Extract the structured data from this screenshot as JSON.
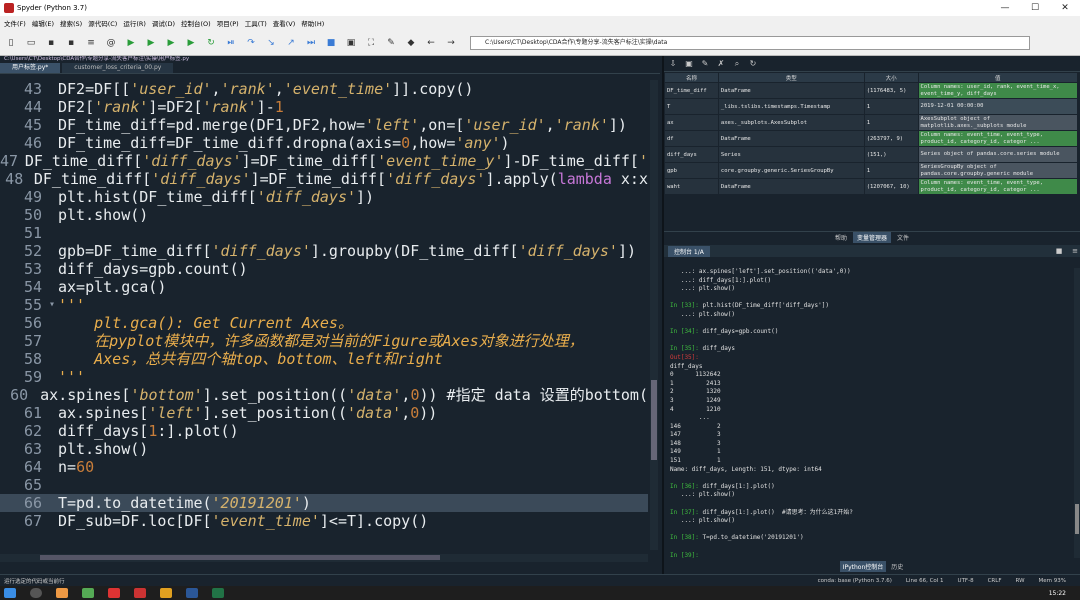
{
  "window": {
    "title": "Spyder (Python 3.7)",
    "minimize": "—",
    "maximize": "☐",
    "close": "✕"
  },
  "menu": [
    "文件(F)",
    "编辑(E)",
    "搜索(S)",
    "源代码(C)",
    "运行(R)",
    "调试(D)",
    "控制台(O)",
    "项目(P)",
    "工具(T)",
    "查看(V)",
    "帮助(H)"
  ],
  "toolbar": {
    "path": "C:\\Users\\CT\\Desktop\\CDA合作\\专题分享-流失客户标注\\实操\\data",
    "icons": [
      "new-file-icon",
      "open-folder-icon",
      "save-icon",
      "save-all-icon",
      "list-icon",
      "at-icon",
      "run-icon",
      "run-cell-icon",
      "run-cell-advance-icon",
      "run-selection-icon",
      "rerun-icon",
      "debug-icon",
      "step-icon",
      "step-into-icon",
      "step-return-icon",
      "continue-icon",
      "stop-icon",
      "maximize-pane-icon",
      "fullscreen-icon",
      "wrench-icon",
      "python-path-icon",
      "back-icon",
      "forward-icon"
    ]
  },
  "editor": {
    "path": "C:\\Users\\CT\\Desktop\\CDA合作\\专题分享-流失客户标注\\实操\\用户标签.py",
    "tabs": [
      {
        "label": "用户标签.py*",
        "active": true
      },
      {
        "label": "customer_loss_criteria_00.py",
        "active": false
      }
    ],
    "lines": [
      {
        "n": "43",
        "html": "DF2=DF[[<span class='str'>'user_id'</span>,<span class='str'>'rank'</span>,<span class='str'>'event_time'</span>]].copy()"
      },
      {
        "n": "44",
        "html": "DF2[<span class='str'>'rank'</span>]=DF2[<span class='str'>'rank'</span>]-<span class='num'>1</span>"
      },
      {
        "n": "45",
        "html": "DF_time_diff=pd.merge(DF1,DF2,how=<span class='str'>'left'</span>,on=[<span class='str'>'user_id'</span>,<span class='str'>'rank'</span>])"
      },
      {
        "n": "46",
        "html": "DF_time_diff=DF_time_diff.dropna(axis=<span class='num'>0</span>,how=<span class='str'>'any'</span>)"
      },
      {
        "n": "47",
        "html": "DF_time_diff[<span class='str'>'diff_days'</span>]=DF_time_diff[<span class='str'>'event_time_y'</span>]-DF_time_diff[<span class='str'>'</span>"
      },
      {
        "n": "48",
        "html": "DF_time_diff[<span class='str'>'diff_days'</span>]=DF_time_diff[<span class='str'>'diff_days'</span>].apply(<span class='kw'>lambda</span> x:x"
      },
      {
        "n": "49",
        "html": "plt.hist(DF_time_diff[<span class='str'>'diff_days'</span>])"
      },
      {
        "n": "50",
        "html": "plt.show()"
      },
      {
        "n": "51",
        "html": ""
      },
      {
        "n": "52",
        "html": "gpb=DF_time_diff[<span class='str'>'diff_days'</span>].groupby(DF_time_diff[<span class='str'>'diff_days'</span>])"
      },
      {
        "n": "53",
        "html": "diff_days=gpb.count()"
      },
      {
        "n": "54",
        "html": "ax=plt.gca()"
      },
      {
        "n": "55",
        "fold": "▾",
        "html": "<span class='doc'>'''</span>"
      },
      {
        "n": "56",
        "html": "<span class='doc'>    plt.gca(): Get Current Axes。</span>"
      },
      {
        "n": "57",
        "html": "<span class='doc'>    在pyplot模块中，许多函数都是对当前的Figure或Axes对象进行处理，</span>"
      },
      {
        "n": "58",
        "html": "<span class='doc'>    Axes，总共有四个轴top、bottom、left和right</span>"
      },
      {
        "n": "59",
        "html": "<span class='doc'>'''</span>"
      },
      {
        "n": "60",
        "html": "ax.spines[<span class='str'>'bottom'</span>].set_position((<span class='str'>'data'</span>,<span class='num'>0</span>)) #指定 data 设置的bottom("
      },
      {
        "n": "61",
        "html": "ax.spines[<span class='str'>'left'</span>].set_position((<span class='str'>'data'</span>,<span class='num'>0</span>))"
      },
      {
        "n": "62",
        "html": "diff_days[<span class='num'>1</span>:].plot()"
      },
      {
        "n": "63",
        "html": "plt.show()"
      },
      {
        "n": "64",
        "html": "n=<span class='num'>60</span>"
      },
      {
        "n": "65",
        "html": ""
      },
      {
        "n": "66",
        "hl": true,
        "html": "T=pd.to_datetime(<span class='str'>'20191201'</span>)"
      },
      {
        "n": "67",
        "html": "DF_sub=DF.loc[DF[<span class='str'>'event_time'</span>]&lt;=T].copy()"
      }
    ]
  },
  "variables": {
    "headers": [
      "名称",
      "类型",
      "大小",
      "值"
    ],
    "rows": [
      {
        "name": "DF_time_diff",
        "type": "DataFrame",
        "size": "(1176483, 5)",
        "value": "Column names: user_id, rank, event_time_x, event_time_y, diff_days",
        "cls": "val"
      },
      {
        "name": "T",
        "type": "_libs.tslibs.timestamps.Timestamp",
        "size": "1",
        "value": "2019-12-01 00:00:00",
        "cls": "val yellowish"
      },
      {
        "name": "ax",
        "type": "axes._subplots.AxesSubplot",
        "size": "1",
        "value": "AxesSubplot object of matplotlib.axes._subplots module",
        "cls": "val grey"
      },
      {
        "name": "df",
        "type": "DataFrame",
        "size": "(263797, 9)",
        "value": "Column names: event_time, event_type, product_id, category_id, categor ...",
        "cls": "val"
      },
      {
        "name": "diff_days",
        "type": "Series",
        "size": "(151,)",
        "value": "Series object of pandas.core.series module",
        "cls": "val grey"
      },
      {
        "name": "gpb",
        "type": "core.groupby.generic.SeriesGroupBy",
        "size": "1",
        "value": "SeriesGroupBy object of pandas.core.groupby.generic module",
        "cls": "val grey"
      },
      {
        "name": "waht",
        "type": "DataFrame",
        "size": "(1207067, 10)",
        "value": "Column names: event_time, event_type, product_id, category_id, categor ...",
        "cls": "val"
      }
    ],
    "tabs": [
      {
        "label": "帮助",
        "active": false
      },
      {
        "label": "变量管理器",
        "active": true
      },
      {
        "label": "文件",
        "active": false
      }
    ]
  },
  "console": {
    "tab": "控制台 1/A",
    "text": "   ...: ax.spines['left'].set_position(('data',0))\n   ...: diff_days[1:].plot()\n   ...: plt.show()\n\nIn [33]: plt.hist(DF_time_diff['diff_days'])\n   ...: plt.show()\n\nIn [34]: diff_days=gpb.count()\n\nIn [35]: diff_days\nOut[35]:\ndiff_days\n0      1132642\n1         2413\n2         1320\n3         1249\n4         1210\n        ...\n146          2\n147          3\n148          3\n149          1\n151          1\nName: diff_days, Length: 151, dtype: int64\n\nIn [36]: diff_days[1:].plot()\n   ...: plt.show()\n\nIn [37]: diff_days[1:].plot()  #请思考：为什么这1开始?\n   ...: plt.show()\n\nIn [38]: T=pd.to_datetime('20191201')\n\nIn [39]: ",
    "bottom_tabs": [
      {
        "label": "IPython控制台",
        "active": true
      },
      {
        "label": "历史",
        "active": false
      }
    ]
  },
  "status": {
    "left": "运行选定的代码或当前行",
    "items": [
      "conda: base (Python 3.7.6)",
      "Line 66, Col 1",
      "UTF-8",
      "CRLF",
      "RW",
      "Mem 93%"
    ]
  },
  "taskbar": {
    "clock": "15:22"
  }
}
